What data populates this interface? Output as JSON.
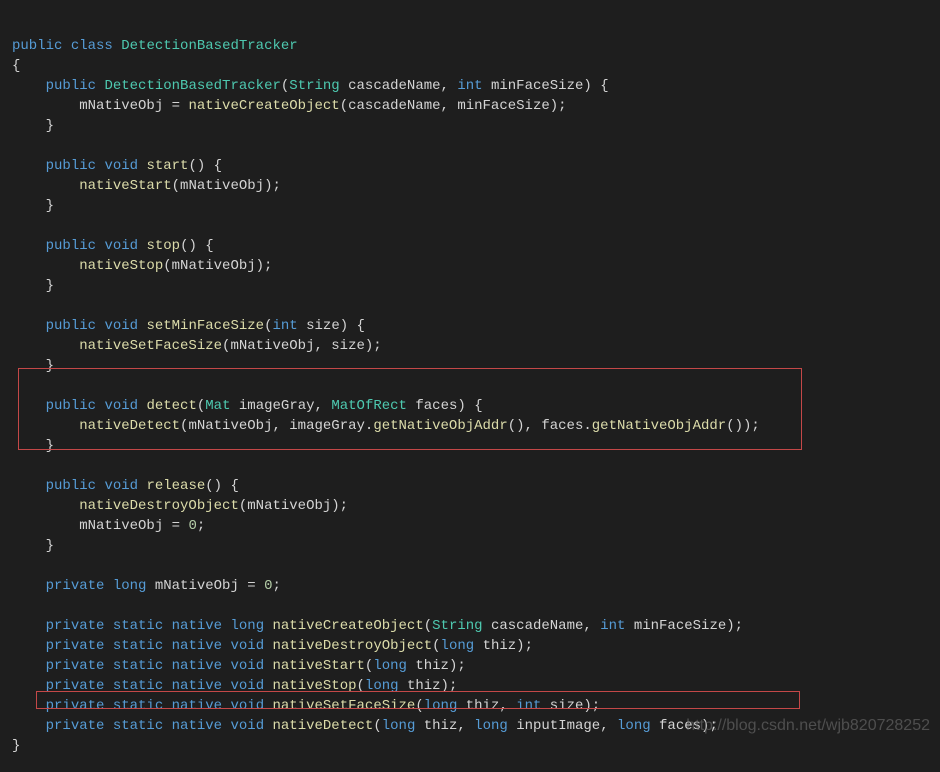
{
  "code": {
    "l01_kw1": "public",
    "l01_kw2": "class",
    "l01_name": "DetectionBasedTracker",
    "l02": "{",
    "l03_kw": "public",
    "l03_ctor": "DetectionBasedTracker",
    "l03_p1t": "String",
    "l03_p1n": "cascadeName",
    "l03_p2t": "int",
    "l03_p2n": "minFaceSize",
    "l04_lhs": "mNativeObj",
    "l04_fn": "nativeCreateObject",
    "l04_a1": "cascadeName",
    "l04_a2": "minFaceSize",
    "l05": "}",
    "l07_kw1": "public",
    "l07_kw2": "void",
    "l07_fn": "start",
    "l08_fn": "nativeStart",
    "l08_a1": "mNativeObj",
    "l09": "}",
    "l11_kw1": "public",
    "l11_kw2": "void",
    "l11_fn": "stop",
    "l12_fn": "nativeStop",
    "l12_a1": "mNativeObj",
    "l13": "}",
    "l15_kw1": "public",
    "l15_kw2": "void",
    "l15_fn": "setMinFaceSize",
    "l15_p1t": "int",
    "l15_p1n": "size",
    "l16_fn": "nativeSetFaceSize",
    "l16_a1": "mNativeObj",
    "l16_a2": "size",
    "l17": "}",
    "l19_kw1": "public",
    "l19_kw2": "void",
    "l19_fn": "detect",
    "l19_p1t": "Mat",
    "l19_p1n": "imageGray",
    "l19_p2t": "MatOfRect",
    "l19_p2n": "faces",
    "l20_fn": "nativeDetect",
    "l20_a1": "mNativeObj",
    "l20_a2": "imageGray",
    "l20_a2m": "getNativeObjAddr",
    "l20_a3": "faces",
    "l20_a3m": "getNativeObjAddr",
    "l21": "}",
    "l23_kw1": "public",
    "l23_kw2": "void",
    "l23_fn": "release",
    "l24_fn": "nativeDestroyObject",
    "l24_a1": "mNativeObj",
    "l25_lhs": "mNativeObj",
    "l25_val": "0",
    "l26": "}",
    "l28_kw1": "private",
    "l28_kw2": "long",
    "l28_name": "mNativeObj",
    "l28_val": "0",
    "l30_kw1": "private",
    "l30_kw2": "static",
    "l30_kw3": "native",
    "l30_kw4": "long",
    "l30_fn": "nativeCreateObject",
    "l30_p1t": "String",
    "l30_p1n": "cascadeName",
    "l30_p2t": "int",
    "l30_p2n": "minFaceSize",
    "l31_kw1": "private",
    "l31_kw2": "static",
    "l31_kw3": "native",
    "l31_kw4": "void",
    "l31_fn": "nativeDestroyObject",
    "l31_p1t": "long",
    "l31_p1n": "thiz",
    "l32_kw1": "private",
    "l32_kw2": "static",
    "l32_kw3": "native",
    "l32_kw4": "void",
    "l32_fn": "nativeStart",
    "l32_p1t": "long",
    "l32_p1n": "thiz",
    "l33_kw1": "private",
    "l33_kw2": "static",
    "l33_kw3": "native",
    "l33_kw4": "void",
    "l33_fn": "nativeStop",
    "l33_p1t": "long",
    "l33_p1n": "thiz",
    "l34_kw1": "private",
    "l34_kw2": "static",
    "l34_kw3": "native",
    "l34_kw4": "void",
    "l34_fn": "nativeSetFaceSize",
    "l34_p1t": "long",
    "l34_p1n": "thiz",
    "l34_p2t": "int",
    "l34_p2n": "size",
    "l35_kw1": "private",
    "l35_kw2": "static",
    "l35_kw3": "native",
    "l35_kw4": "void",
    "l35_fn": "nativeDetect",
    "l35_p1t": "long",
    "l35_p1n": "thiz",
    "l35_p2t": "long",
    "l35_p2n": "inputImage",
    "l35_p3t": "long",
    "l35_p3n": "faces",
    "l36": "}"
  },
  "watermark": "http://blog.csdn.net/wjb820728252"
}
